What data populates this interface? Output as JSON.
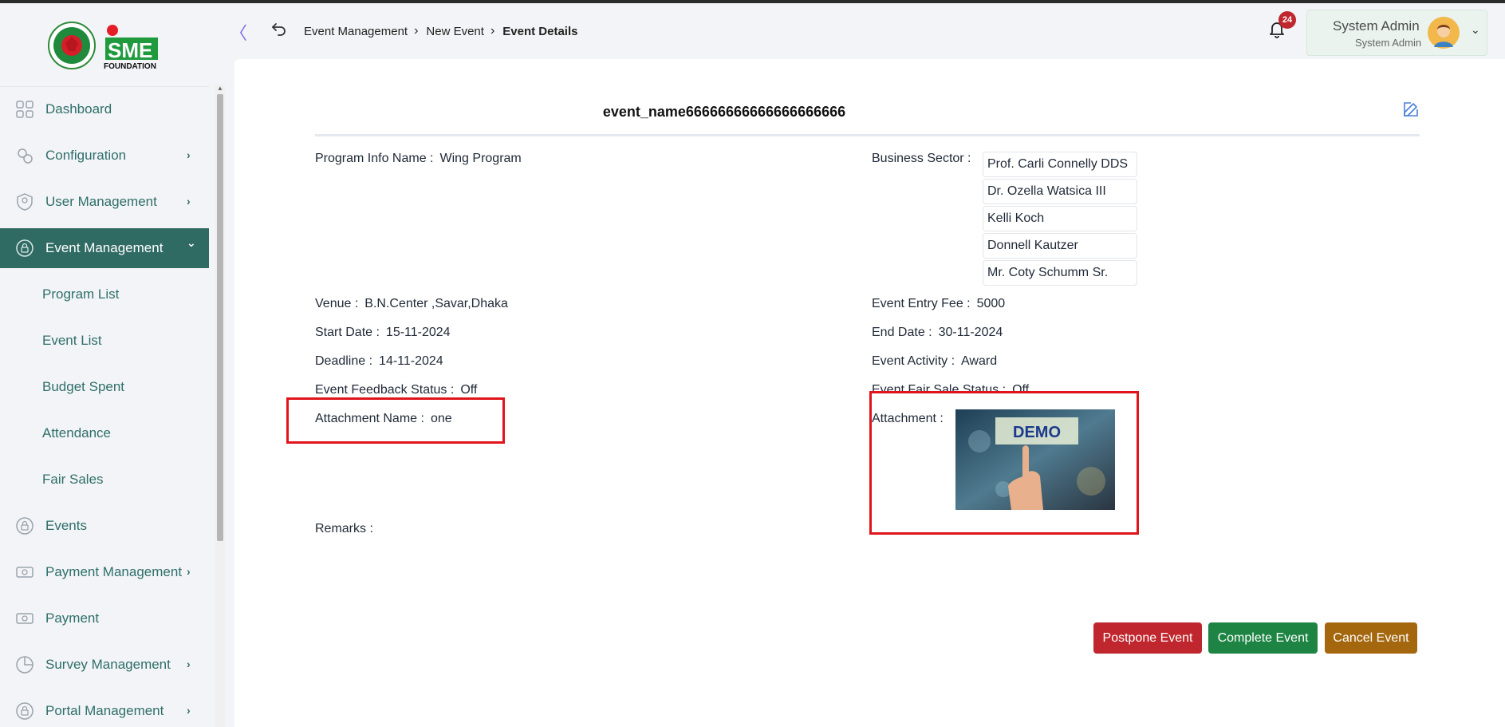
{
  "brand": {
    "logo_text": "SME",
    "logo_sub": "FOUNDATION"
  },
  "sidebar": {
    "items": [
      {
        "label": "Dashboard",
        "icon": "grid-icon",
        "has_chevron": false
      },
      {
        "label": "Configuration",
        "icon": "gears-icon",
        "has_chevron": true
      },
      {
        "label": "User Management",
        "icon": "user-shield-icon",
        "has_chevron": true
      },
      {
        "label": "Event Management",
        "icon": "lock-circle-icon",
        "has_chevron": true,
        "active": true
      },
      {
        "label": "Events",
        "icon": "lock-circle-icon",
        "has_chevron": false
      },
      {
        "label": "Payment Management",
        "icon": "cash-icon",
        "has_chevron": true
      },
      {
        "label": "Payment",
        "icon": "cash-icon",
        "has_chevron": false
      },
      {
        "label": "Survey Management",
        "icon": "pie-icon",
        "has_chevron": true
      },
      {
        "label": "Portal Management",
        "icon": "lock-circle-icon",
        "has_chevron": true
      }
    ],
    "subitems": [
      "Program List",
      "Event List",
      "Budget Spent",
      "Attendance",
      "Fair Sales"
    ],
    "chevron_right": "›",
    "chevron_down": "⌄"
  },
  "header": {
    "breadcrumb": [
      "Event Management",
      "New Event",
      "Event Details"
    ],
    "notifications": "24",
    "user_name": "System Admin",
    "user_role": "System Admin"
  },
  "event": {
    "title": "event_name66666666666666666666",
    "program_info_label": "Program Info Name :",
    "program_info": "Wing Program",
    "business_sector_label": "Business Sector :",
    "business_sectors": [
      "Prof. Carli Connelly DDS",
      "Dr. Ozella Watsica III",
      "Kelli Koch",
      "Donnell Kautzer",
      "Mr. Coty Schumm Sr."
    ],
    "venue_label": "Venue :",
    "venue": "B.N.Center ,Savar,Dhaka",
    "entry_fee_label": "Event Entry Fee :",
    "entry_fee": "5000",
    "start_date_label": "Start Date :",
    "start_date": "15-11-2024",
    "end_date_label": "End Date :",
    "end_date": "30-11-2024",
    "deadline_label": "Deadline :",
    "deadline": "14-11-2024",
    "activity_label": "Event Activity :",
    "activity": "Award",
    "feedback_label": "Event Feedback Status :",
    "feedback": "Off",
    "fair_sale_label": "Event Fair Sale Status :",
    "fair_sale": "Off",
    "attachment_name_label": "Attachment Name :",
    "attachment_name": "one",
    "attachment_label": "Attachment :",
    "attachment_image_text": "DEMO",
    "remarks_label": "Remarks :"
  },
  "actions": {
    "postpone": "Postpone Event",
    "complete": "Complete Event",
    "cancel": "Cancel Event"
  },
  "colors": {
    "primary": "#2f6b63",
    "postpone": "#c0262d",
    "complete": "#1e8444",
    "cancel": "#a4670e",
    "highlight": "#e0141b"
  }
}
